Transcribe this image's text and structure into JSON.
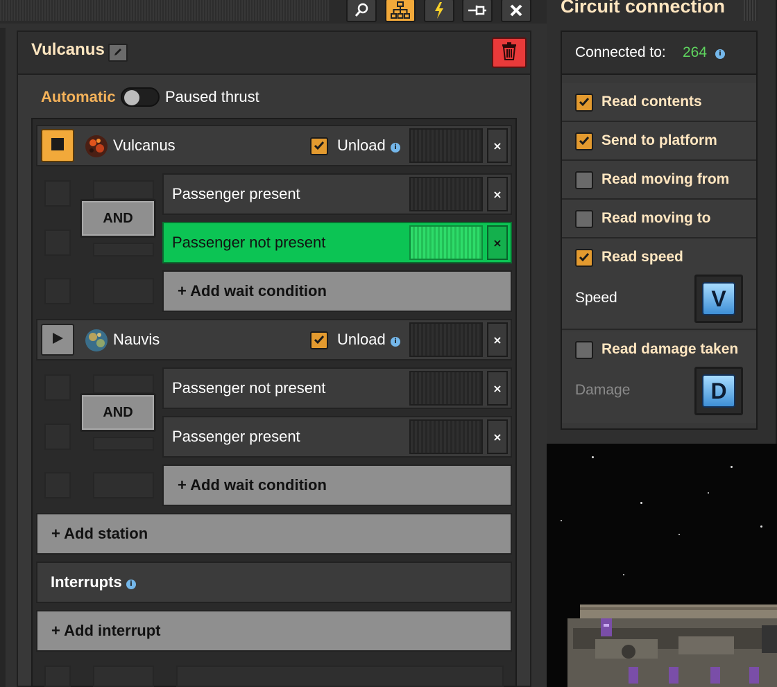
{
  "station_panel": {
    "title": "Vulcanus",
    "automatic_label": "Automatic",
    "paused_label": "Paused thrust",
    "stations": [
      {
        "name": "Vulcanus",
        "unload_label": "Unload",
        "conditions": [
          "Passenger present",
          "Passenger not present"
        ],
        "logic": "AND",
        "add_wait_label": "+ Add wait condition"
      },
      {
        "name": "Nauvis",
        "unload_label": "Unload",
        "conditions": [
          "Passenger not present",
          "Passenger present"
        ],
        "logic": "AND",
        "add_wait_label": "+ Add wait condition"
      }
    ],
    "add_station_label": "+ Add station",
    "interrupts_label": "Interrupts",
    "add_interrupt_label": "+ Add interrupt",
    "close_glyph": "×"
  },
  "circuit_panel": {
    "title": "Circuit connection",
    "connected_label": "Connected to:",
    "connected_value": "264",
    "options": [
      {
        "label": "Read contents",
        "checked": true
      },
      {
        "label": "Send to platform",
        "checked": true
      },
      {
        "label": "Read moving from",
        "checked": false
      },
      {
        "label": "Read moving to",
        "checked": false
      },
      {
        "label": "Read speed",
        "checked": true
      },
      {
        "label": "Read damage taken",
        "checked": false
      }
    ],
    "speed_label": "Speed",
    "speed_signal": "V",
    "damage_label": "Damage",
    "damage_signal": "D"
  },
  "colors": {
    "accent_orange": "#f2a93a",
    "active_condition_green": "#0cc454",
    "connected_value_green": "#5ed35e",
    "delete_red": "#e93a3a"
  }
}
